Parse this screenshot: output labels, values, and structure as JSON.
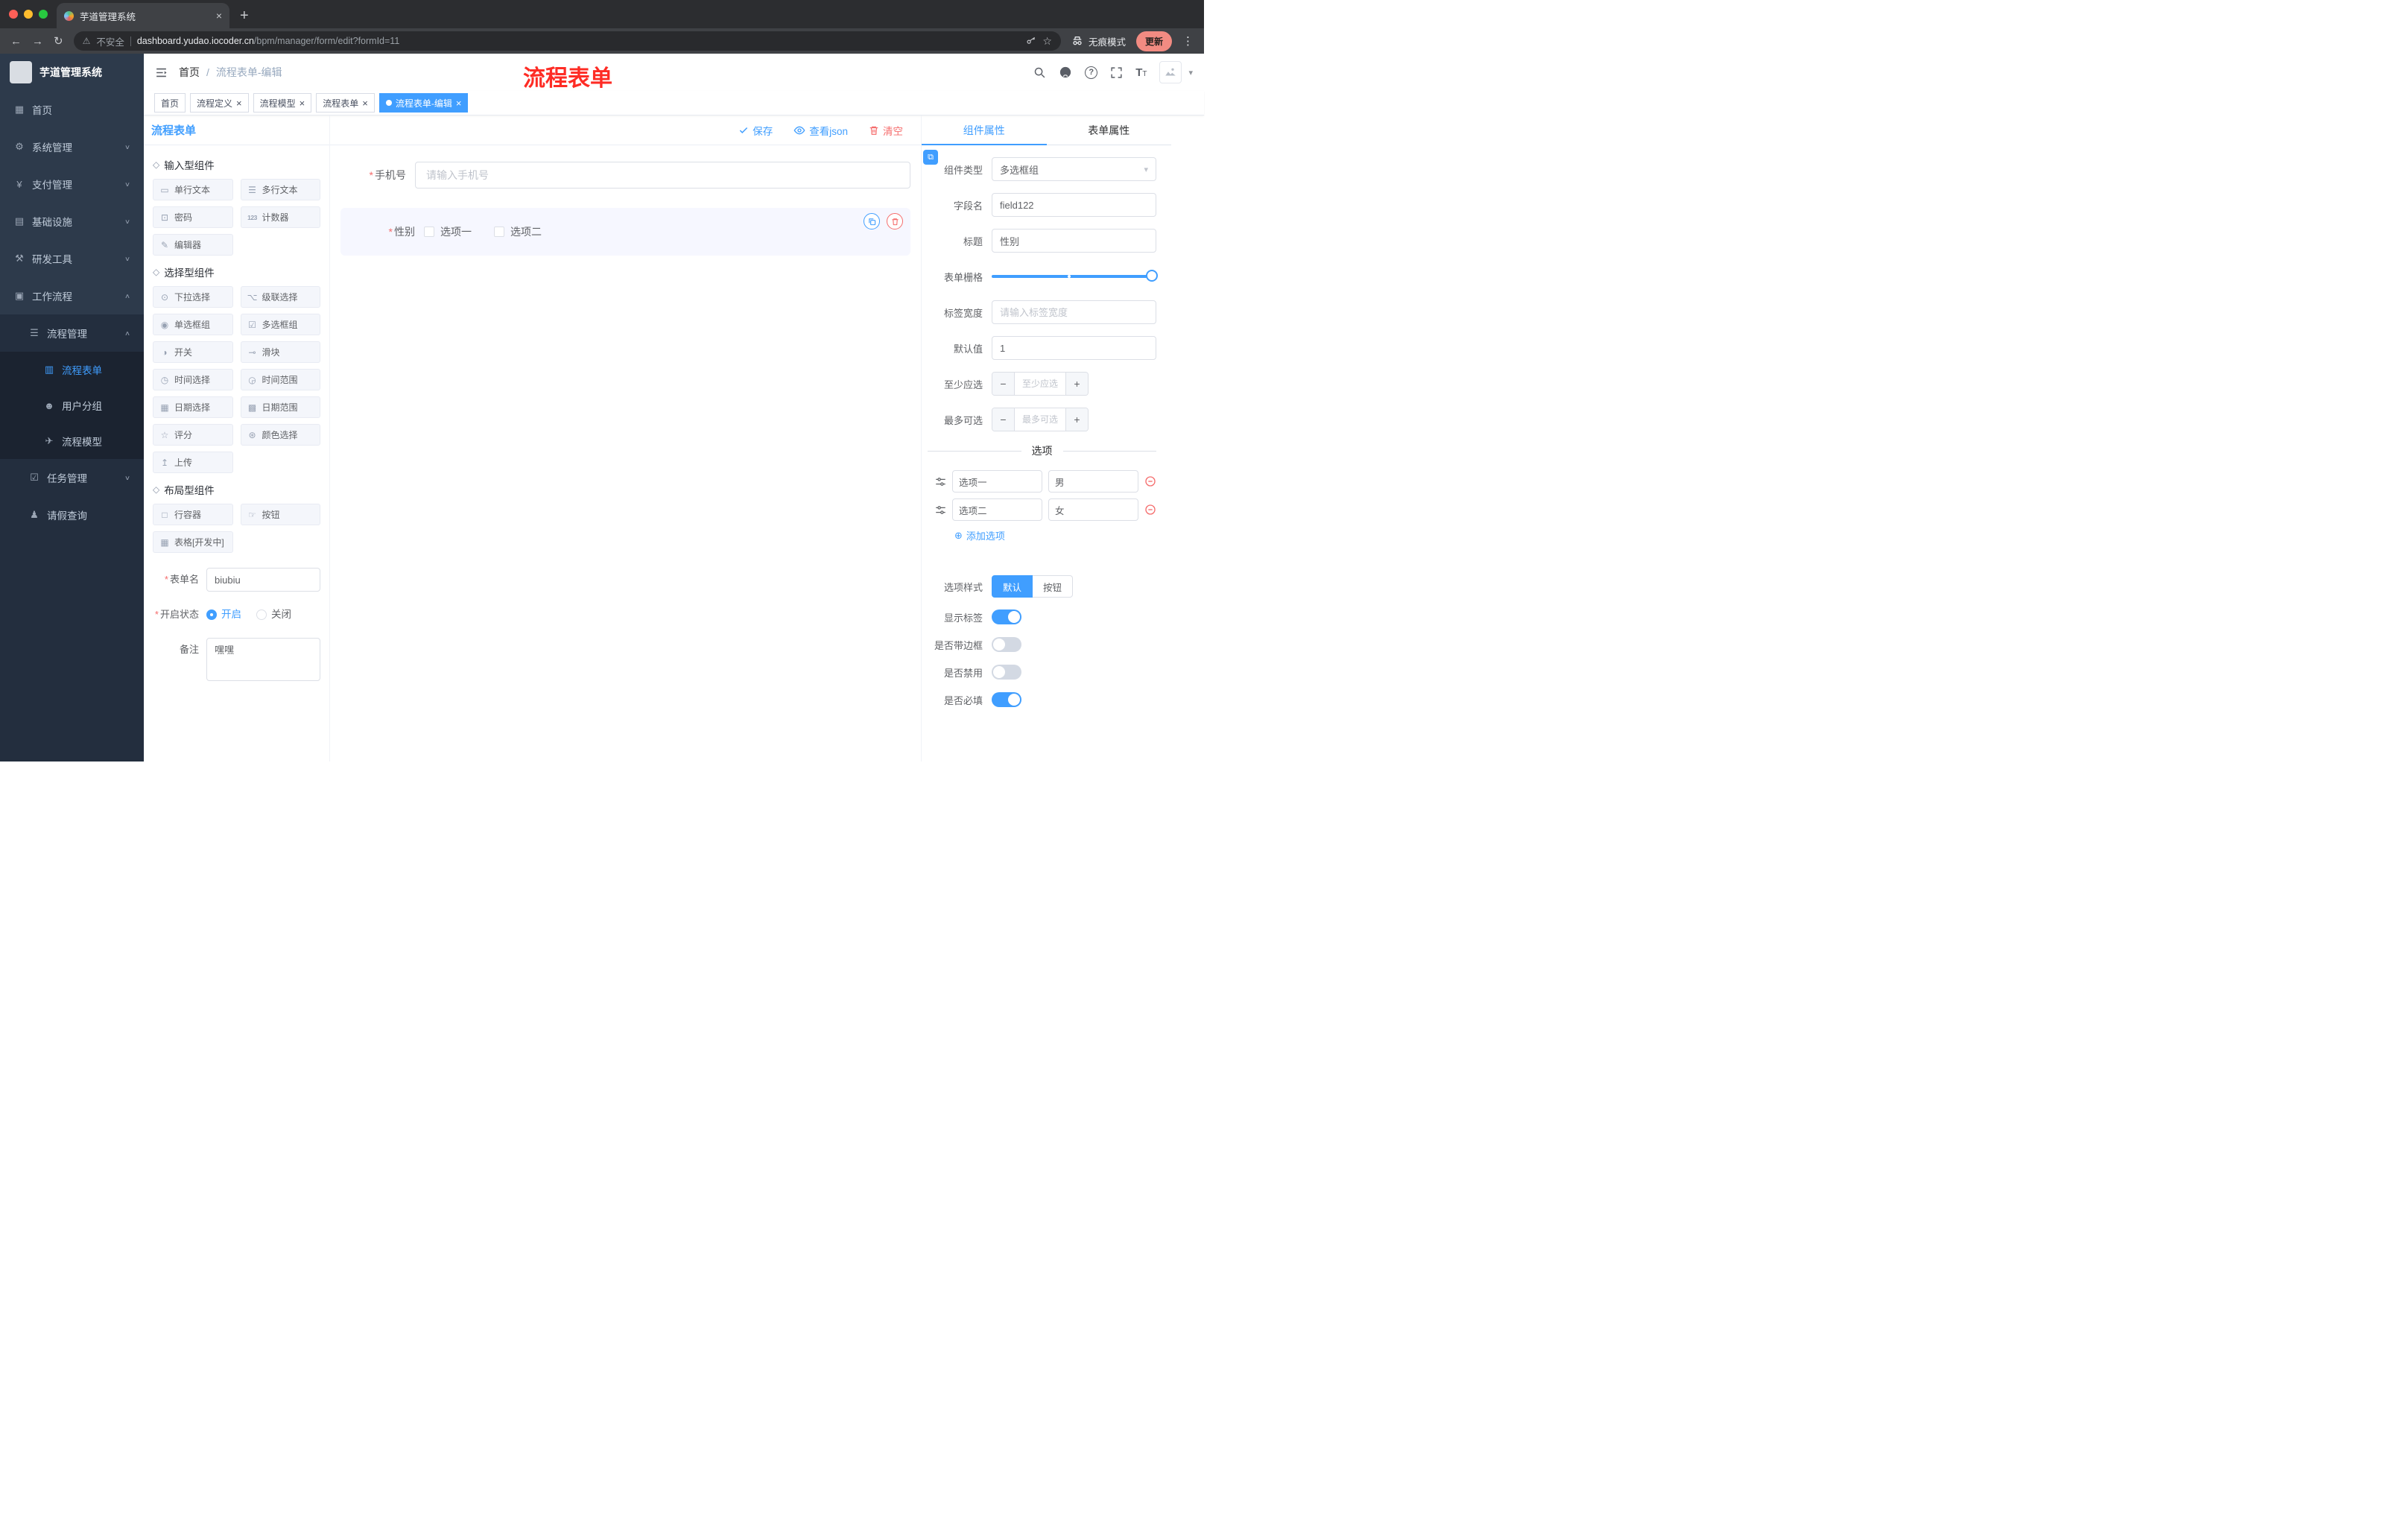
{
  "theme": {
    "accent": "#409eff",
    "danger": "#f56c6c",
    "annotation": "#fe2c25",
    "sidebar-bg": "#2d3a4b",
    "sidebar-sub": "#232e3e",
    "sidebar-deep": "#1b2330",
    "chrome-bg": "#2c2d30",
    "chrome-tab": "#3f4145",
    "chrome-field": "#292a2d"
  },
  "icons": {
    "back": "←",
    "forward": "→",
    "reload": "↻",
    "home": "⌂",
    "warning": "⚠",
    "star": "☆",
    "close": "×",
    "plus_tab": "+",
    "menu_dots": "⋮",
    "dashboard": "▦",
    "gear": "⚙",
    "yen": "¥",
    "monitor": "▤",
    "tools": "⚒",
    "suitcase": "▣",
    "list": "☰",
    "doc": "▥",
    "users": "☻",
    "plane": "✈",
    "tree": "☑",
    "person": "♟",
    "chevron_down": "∨",
    "chevron_up": "∧",
    "caret_down": "▾",
    "cube": "◇",
    "input": "▭",
    "textarea": "☰",
    "lock": "⊡",
    "counter": "123",
    "editor": "✎",
    "select": "⊙",
    "cascade": "⌥",
    "radio": "◉",
    "checkbox": "☑",
    "switch": "◑",
    "slider": "⊸",
    "time": "◷",
    "time_range": "◶",
    "date": "▦",
    "date_range": "▩",
    "rate": "☆",
    "color": "⊛",
    "upload": "↥",
    "row": "□",
    "button": "☞",
    "table": "▦",
    "required": "*",
    "add": "⊕",
    "question": "?",
    "link": "⧉",
    "t_big": "T",
    "t_small": "T"
  },
  "browser": {
    "tab_title": "芋道管理系统",
    "security_label": "不安全",
    "url_host": "dashboard.yudao.iocoder.cn",
    "url_path": "/bpm/manager/form/edit?formId=11",
    "incognito_label": "无痕模式",
    "update_label": "更新"
  },
  "sidebar": {
    "logo_title": "芋道管理系统",
    "menu": [
      "首页",
      "系统管理",
      "支付管理",
      "基础设施",
      "研发工具",
      "工作流程",
      "流程管理",
      "流程表单",
      "用户分组",
      "流程模型",
      "任务管理",
      "请假查询"
    ]
  },
  "header": {
    "breadcrumb_home": "首页",
    "breadcrumb_sep": "/",
    "breadcrumb_current": "流程表单-编辑",
    "annotation": "流程表单"
  },
  "tags": [
    "首页",
    "流程定义",
    "流程模型",
    "流程表单",
    "流程表单-编辑"
  ],
  "designer": {
    "panel_title": "流程表单",
    "toolbar": {
      "save": "保存",
      "view_json": "查看json",
      "clear": "清空"
    },
    "palette": {
      "sections": [
        {
          "title": "输入型组件",
          "items": [
            "单行文本",
            "多行文本",
            "密码",
            "计数器",
            "编辑器"
          ]
        },
        {
          "title": "选择型组件",
          "items": [
            "下拉选择",
            "级联选择",
            "单选框组",
            "多选框组",
            "开关",
            "滑块",
            "时间选择",
            "时间范围",
            "日期选择",
            "日期范围",
            "评分",
            "颜色选择",
            "上传"
          ]
        },
        {
          "title": "布局型组件",
          "items": [
            "行容器",
            "按钮",
            "表格[开发中]"
          ]
        }
      ]
    },
    "form_settings": {
      "name_label": "表单名",
      "name_value": "biubiu",
      "status_label": "开启状态",
      "status_on": "开启",
      "status_off": "关闭",
      "remark_label": "备注",
      "remark_value": "嘿嘿"
    },
    "canvas": {
      "phone_label": "手机号",
      "phone_placeholder": "请输入手机号",
      "gender_label": "性别",
      "gender_option1": "选项一",
      "gender_option2": "选项二"
    },
    "props": {
      "tab_component": "组件属性",
      "tab_form": "表单属性",
      "type_label": "组件类型",
      "type_value": "多选框组",
      "field_label": "字段名",
      "field_value": "field122",
      "title_label": "标题",
      "title_value": "性别",
      "grid_label": "表单栅格",
      "label_width_label": "标签宽度",
      "label_width_placeholder": "请输入标签宽度",
      "default_label": "默认值",
      "default_value": "1",
      "min_label": "至少应选",
      "min_placeholder": "至少应选",
      "max_label": "最多可选",
      "max_placeholder": "最多可选",
      "options_title": "选项",
      "options": [
        {
          "label": "选项一",
          "value": "男"
        },
        {
          "label": "选项二",
          "value": "女"
        }
      ],
      "add_option": "添加选项",
      "style_label": "选项样式",
      "style_default": "默认",
      "style_button": "按钮",
      "show_label": "显示标签",
      "border_label": "是否带边框",
      "disabled_label": "是否禁用",
      "required_label": "是否必填"
    }
  }
}
